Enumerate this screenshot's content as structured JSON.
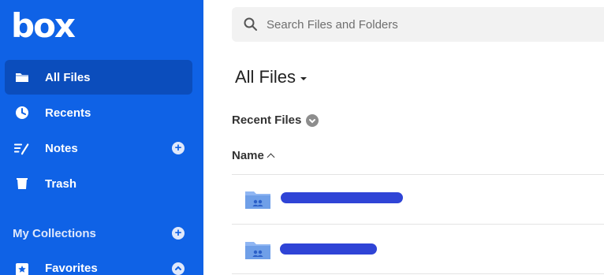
{
  "brand": {
    "logo_text": "box",
    "primary_color": "#0f62e6",
    "active_color": "#0b4dbc"
  },
  "sidebar": {
    "items": [
      {
        "label": "All Files",
        "icon": "folder-icon",
        "active": true
      },
      {
        "label": "Recents",
        "icon": "clock-icon",
        "active": false
      },
      {
        "label": "Notes",
        "icon": "notes-icon",
        "active": false,
        "has_add": true
      },
      {
        "label": "Trash",
        "icon": "trash-icon",
        "active": false
      }
    ],
    "collections_title": "My Collections",
    "favorites_label": "Favorites"
  },
  "search": {
    "placeholder": "Search Files and Folders",
    "value": ""
  },
  "main": {
    "title": "All Files",
    "recent_files_label": "Recent Files",
    "name_column": "Name",
    "files": [
      {
        "name": "",
        "icon": "shared-folder-icon",
        "redacted": true
      },
      {
        "name": "",
        "icon": "shared-folder-icon",
        "redacted": true
      }
    ]
  }
}
